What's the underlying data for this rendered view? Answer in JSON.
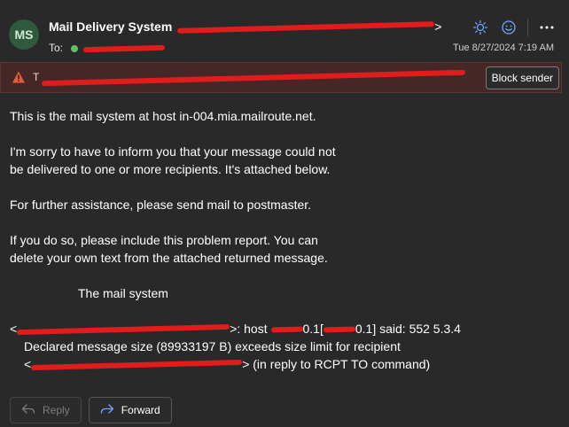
{
  "header": {
    "avatar_initials": "MS",
    "sender_name": "Mail Delivery System",
    "sender_suffix": ">",
    "to_label": "To:",
    "timestamp": "Tue 8/27/2024 7:19 AM"
  },
  "banner": {
    "text_start": "T",
    "block_label": "Block sender"
  },
  "body": {
    "p1": "This is the mail system at host in-004.mia.mailroute.net.",
    "p2a": "I'm sorry to have to inform you that your message could not",
    "p2b": "be delivered to one or more recipients. It's attached below.",
    "p3": "For further assistance, please send mail to postmaster.",
    "p4a": "If you do so, please include this problem report. You can",
    "p4b": "delete your own text from the attached returned message.",
    "signature": "The mail system",
    "diag_start": "<",
    "diag_host": ">: host ",
    "diag_ip_end": "0.1[",
    "diag_said": "0.1] said: 552 5.3.4",
    "diag_line2": "Declared message size (89933197 B) exceeds size limit for recipient",
    "diag_line3_start": "<",
    "diag_line3_end": "> (in reply to RCPT TO command)"
  },
  "actions": {
    "reply_label": "Reply",
    "forward_label": "Forward"
  },
  "colors": {
    "background": "#292929",
    "banner_bg": "#442726",
    "accent": "#6ea8ff",
    "redaction": "#e01c1c",
    "avatar_bg": "#2f5a3c"
  }
}
